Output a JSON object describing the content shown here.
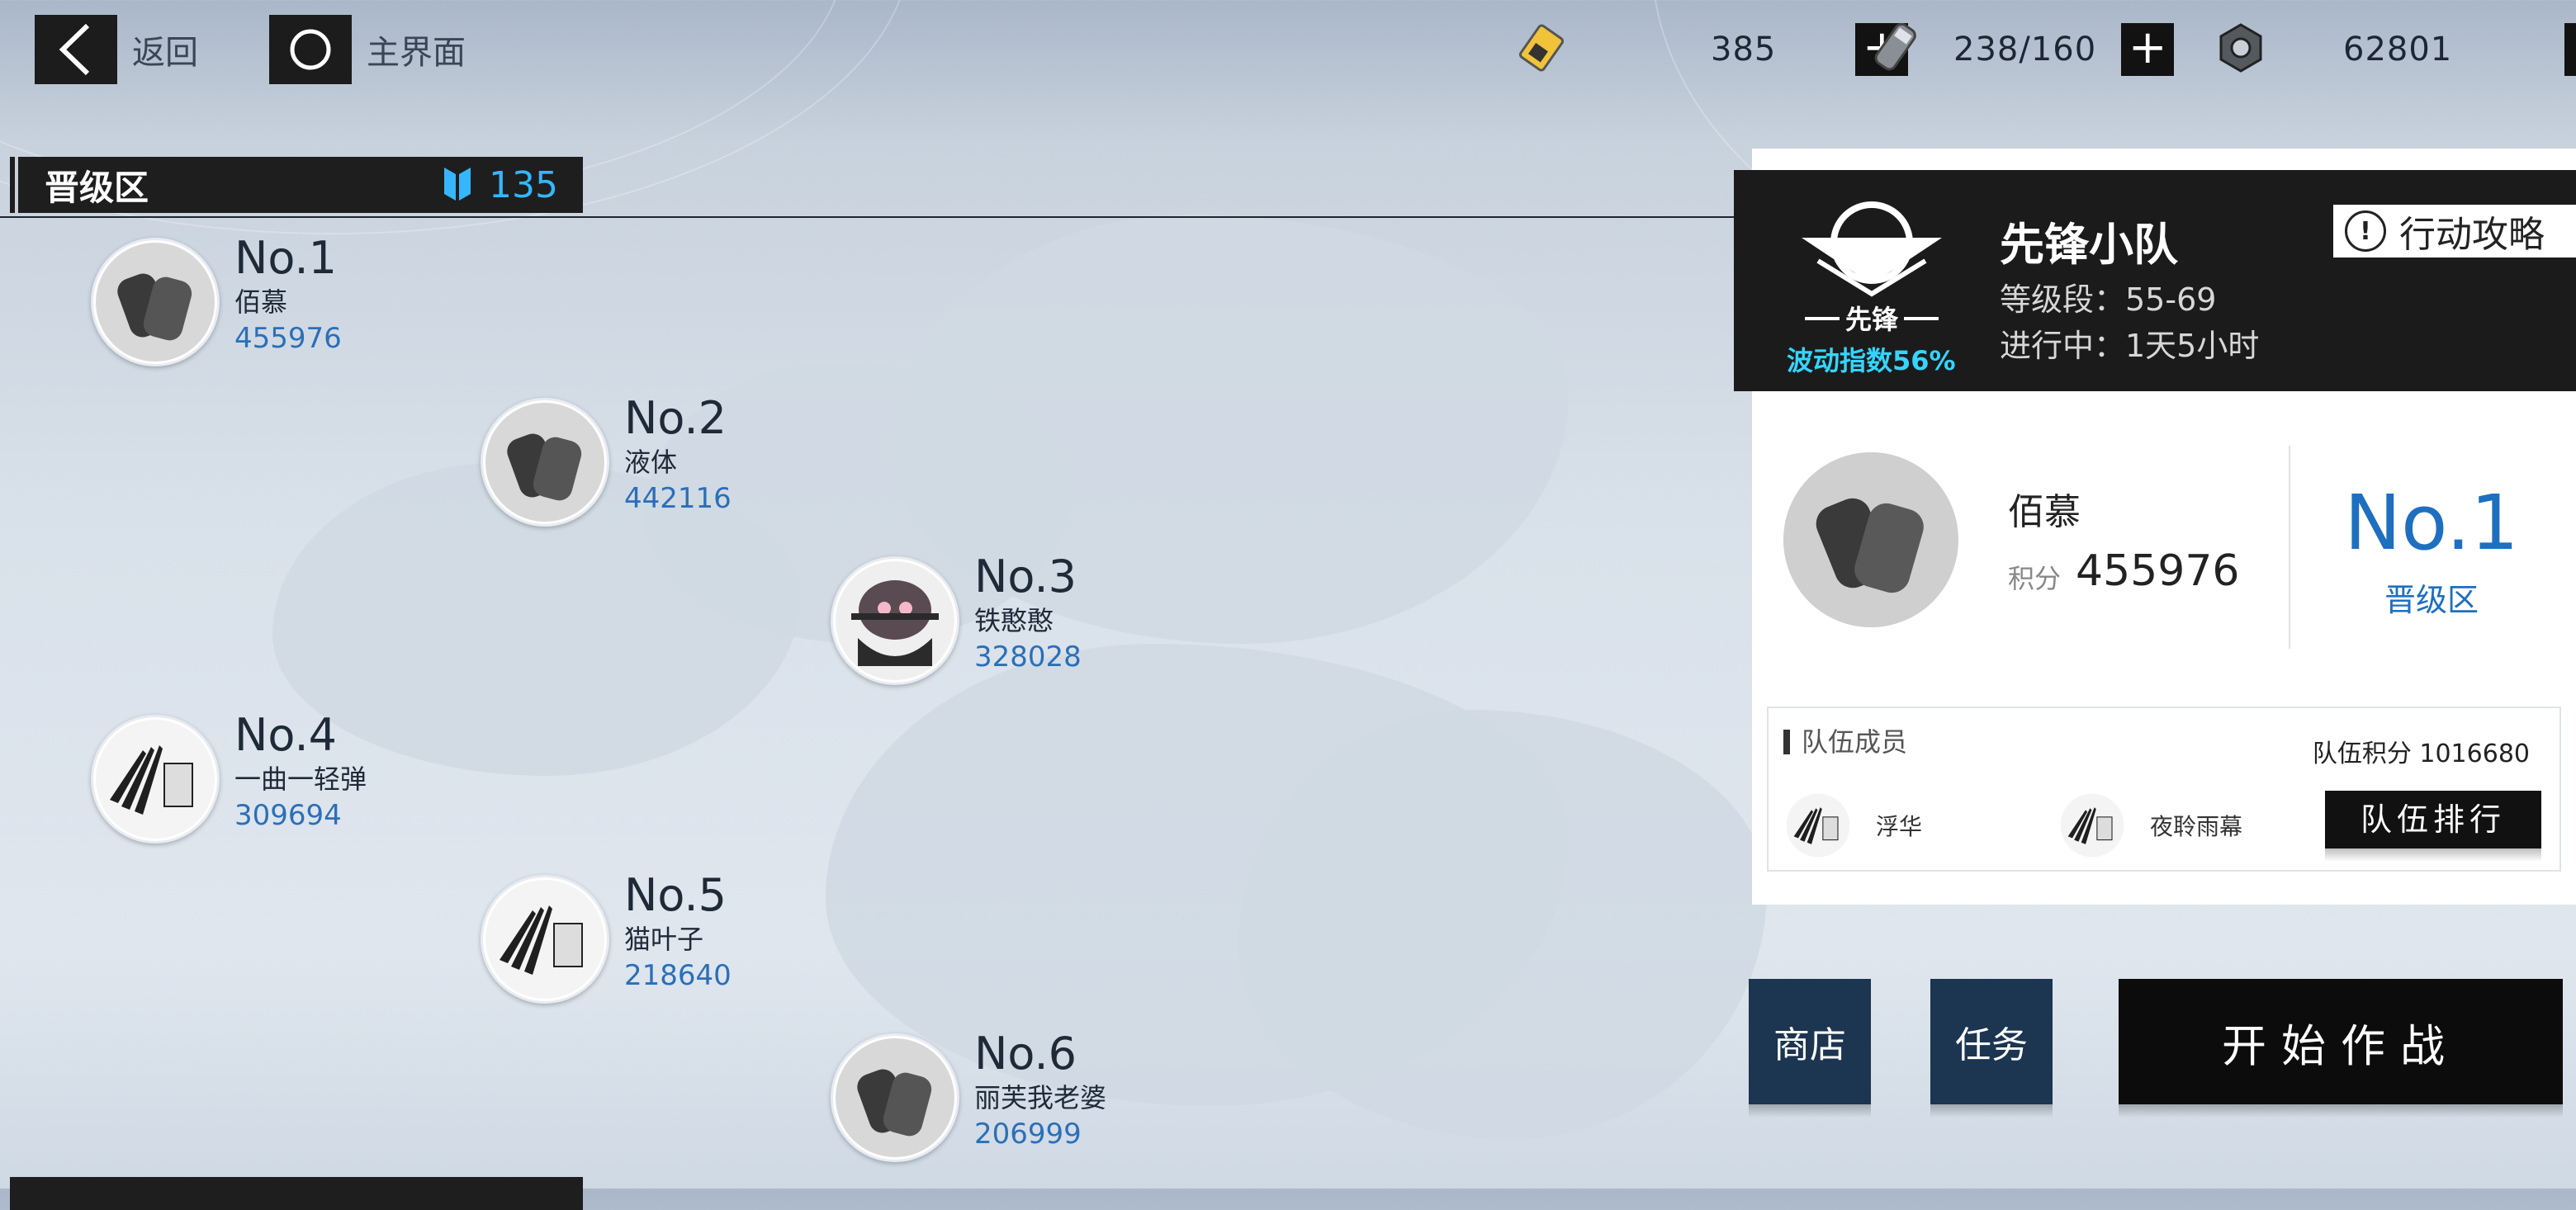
{
  "topbar": {
    "back_label": "返回",
    "home_label": "主界面"
  },
  "resources": [
    {
      "icon": "ticket-icon",
      "value": "385"
    },
    {
      "icon": "battery-icon",
      "value": "238/160"
    },
    {
      "icon": "nut-icon",
      "value": "62801"
    }
  ],
  "zone": {
    "title": "晋级区",
    "count": "135"
  },
  "rankings": [
    {
      "no": "No.1",
      "name": "佰慕",
      "score": "455976",
      "avatar": "dogtag-avatar"
    },
    {
      "no": "No.2",
      "name": "液体",
      "score": "442116",
      "avatar": "dogtag-avatar"
    },
    {
      "no": "No.3",
      "name": "铁憨憨",
      "score": "328028",
      "avatar": "robot-avatar"
    },
    {
      "no": "No.4",
      "name": "一曲一轻弹",
      "score": "309694",
      "avatar": "wing-avatar"
    },
    {
      "no": "No.5",
      "name": "猫叶子",
      "score": "218640",
      "avatar": "wing-avatar"
    },
    {
      "no": "No.6",
      "name": "丽芙我老婆",
      "score": "206999",
      "avatar": "dogtag-avatar"
    }
  ],
  "squad": {
    "name": "先锋小队",
    "emblem_text": "先锋",
    "wave": "波动指数56%",
    "level": "等级段：55-69",
    "status": "进行中：1天5小时",
    "guide": "行动攻略"
  },
  "me": {
    "name": "佰慕",
    "score_label": "积分",
    "score": "455976",
    "rank": "No.1",
    "zone": "晋级区"
  },
  "members": {
    "header": "队伍成员",
    "team_score": "队伍积分  1016680",
    "list": [
      {
        "name": "浮华"
      },
      {
        "name": "夜聆雨幕"
      }
    ],
    "rank_button": "队伍排行"
  },
  "buttons": {
    "shop": "商店",
    "task": "任务",
    "start": "开始作战"
  },
  "colors": {
    "accent_blue": "#2b6fb8",
    "wave_cyan": "#35d4ff",
    "nav_dark": "#1c3550"
  }
}
